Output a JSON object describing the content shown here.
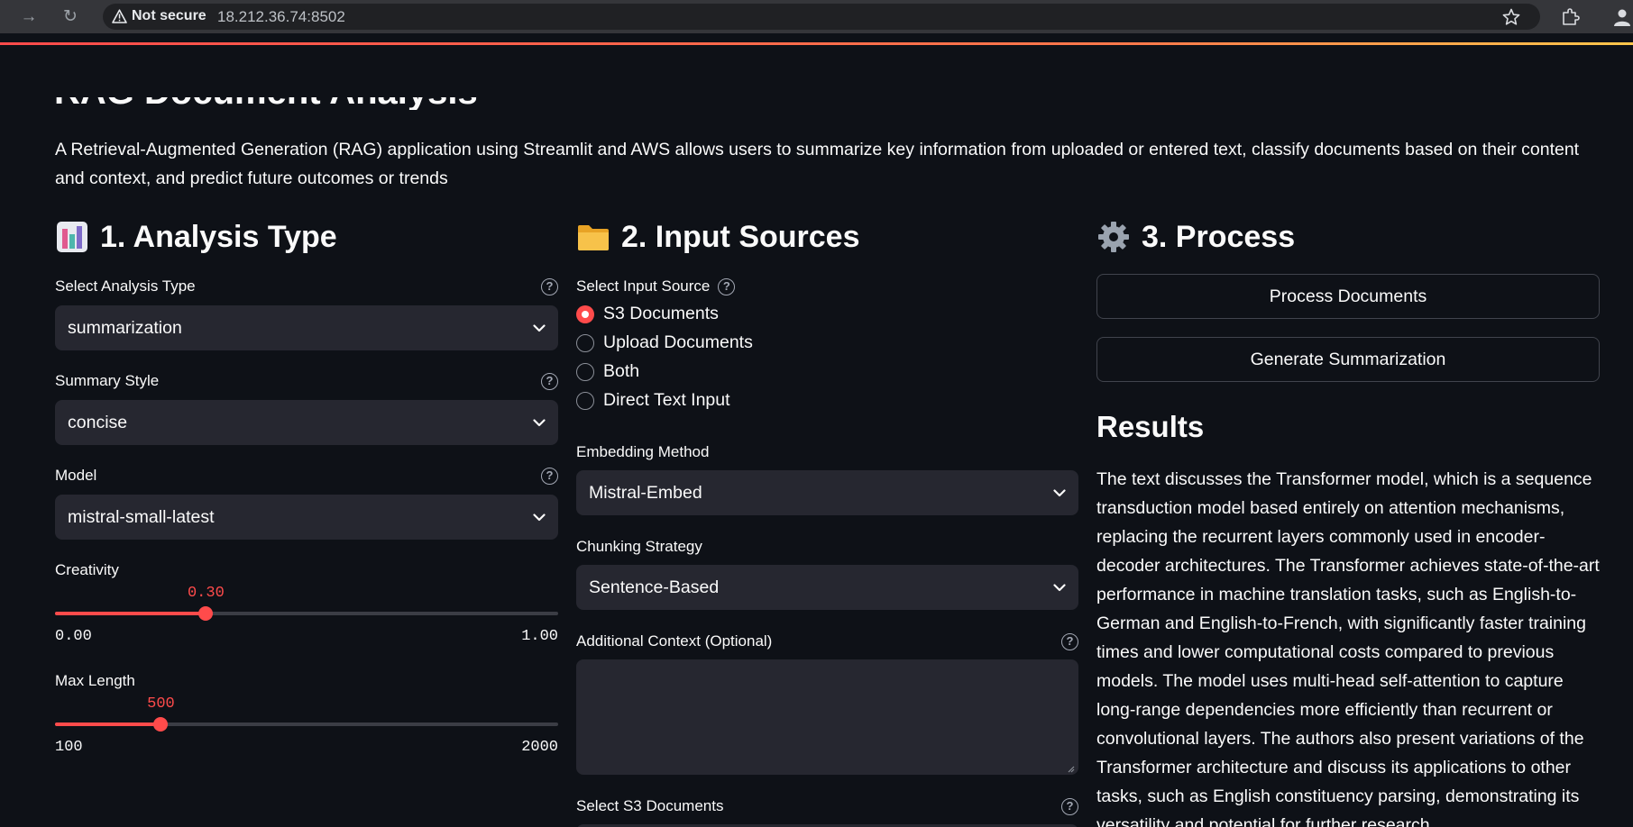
{
  "browser": {
    "security_label": "Not secure",
    "url": "18.212.36.74:8502"
  },
  "app": {
    "title": "RAG Document Analysis",
    "intro": "A Retrieval-Augmented Generation (RAG) application using Streamlit and AWS allows users to summarize key information from uploaded or entered text, classify documents based on their content and context, and predict future outcomes or trends"
  },
  "analysis": {
    "heading": "1. Analysis Type",
    "type_label": "Select Analysis Type",
    "type_value": "summarization",
    "style_label": "Summary Style",
    "style_value": "concise",
    "model_label": "Model",
    "model_value": "mistral-small-latest",
    "creativity": {
      "label": "Creativity",
      "value": "0.30",
      "min": "0.00",
      "max": "1.00",
      "fraction": 0.3
    },
    "max_length": {
      "label": "Max Length",
      "value": "500",
      "min": "100",
      "max": "2000",
      "fraction": 0.2105
    }
  },
  "inputs": {
    "heading": "2. Input Sources",
    "source_label": "Select Input Source",
    "sources": [
      "S3 Documents",
      "Upload Documents",
      "Both",
      "Direct Text Input"
    ],
    "selected_source": "S3 Documents",
    "embedding_label": "Embedding Method",
    "embedding_value": "Mistral-Embed",
    "chunking_label": "Chunking Strategy",
    "chunking_value": "Sentence-Based",
    "context_label": "Additional Context (Optional)",
    "context_value": "",
    "s3_label": "Select S3 Documents"
  },
  "process": {
    "heading": "3. Process",
    "process_button": "Process Documents",
    "generate_button": "Generate Summarization",
    "results_title": "Results",
    "results_text": "The text discusses the Transformer model, which is a sequence transduction model based entirely on attention mechanisms, replacing the recurrent layers commonly used in encoder-decoder architectures. The Transformer achieves state-of-the-art performance in machine translation tasks, such as English-to-German and English-to-French, with significantly faster training times and lower computational costs compared to previous models. The model uses multi-head self-attention to capture long-range dependencies more efficiently than recurrent or convolutional layers. The authors also present variations of the Transformer architecture and discuss its applications to other tasks, such as English constituency parsing, demonstrating its versatility and potential for further research."
  },
  "colors": {
    "accent": "#ff4b4b",
    "background": "#0e1117",
    "widget": "#262730"
  }
}
